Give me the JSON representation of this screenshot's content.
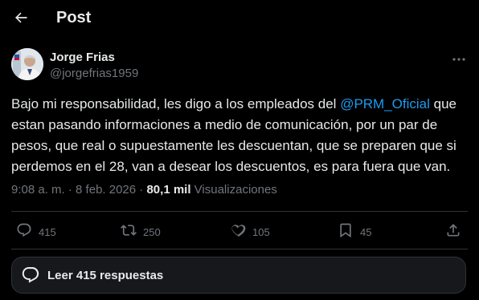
{
  "header": {
    "title": "Post",
    "back_icon": "arrow-left-icon"
  },
  "author": {
    "name": "Jorge Frias",
    "handle": "@jorgefrias1959"
  },
  "tweet": {
    "text_before": "Bajo mi responsabilidad, les digo a los empleados del ",
    "mention": "@PRM_Oficial",
    "text_after": " que estan pasando informaciones a medio de comunicación, por un par de pesos, que real o supuestamente les descuentan, que se preparen que si perdemos en el 28, van a desear los descuentos, es para fuera que van."
  },
  "meta": {
    "time": "9:08 a. m.",
    "separator": " · ",
    "date": "8 feb. 2026",
    "separator2": " · ",
    "views_count": "80,1 mil",
    "views_label": " Visualizaciones"
  },
  "actions": {
    "replies": "415",
    "reposts": "250",
    "likes": "105",
    "bookmarks": "45"
  },
  "replies_button": {
    "label": "Leer 415 respuestas"
  },
  "colors": {
    "background": "#000000",
    "text": "#e7e9ea",
    "muted": "#71767b",
    "accent": "#1d9bf0",
    "divider": "#2f3336"
  }
}
